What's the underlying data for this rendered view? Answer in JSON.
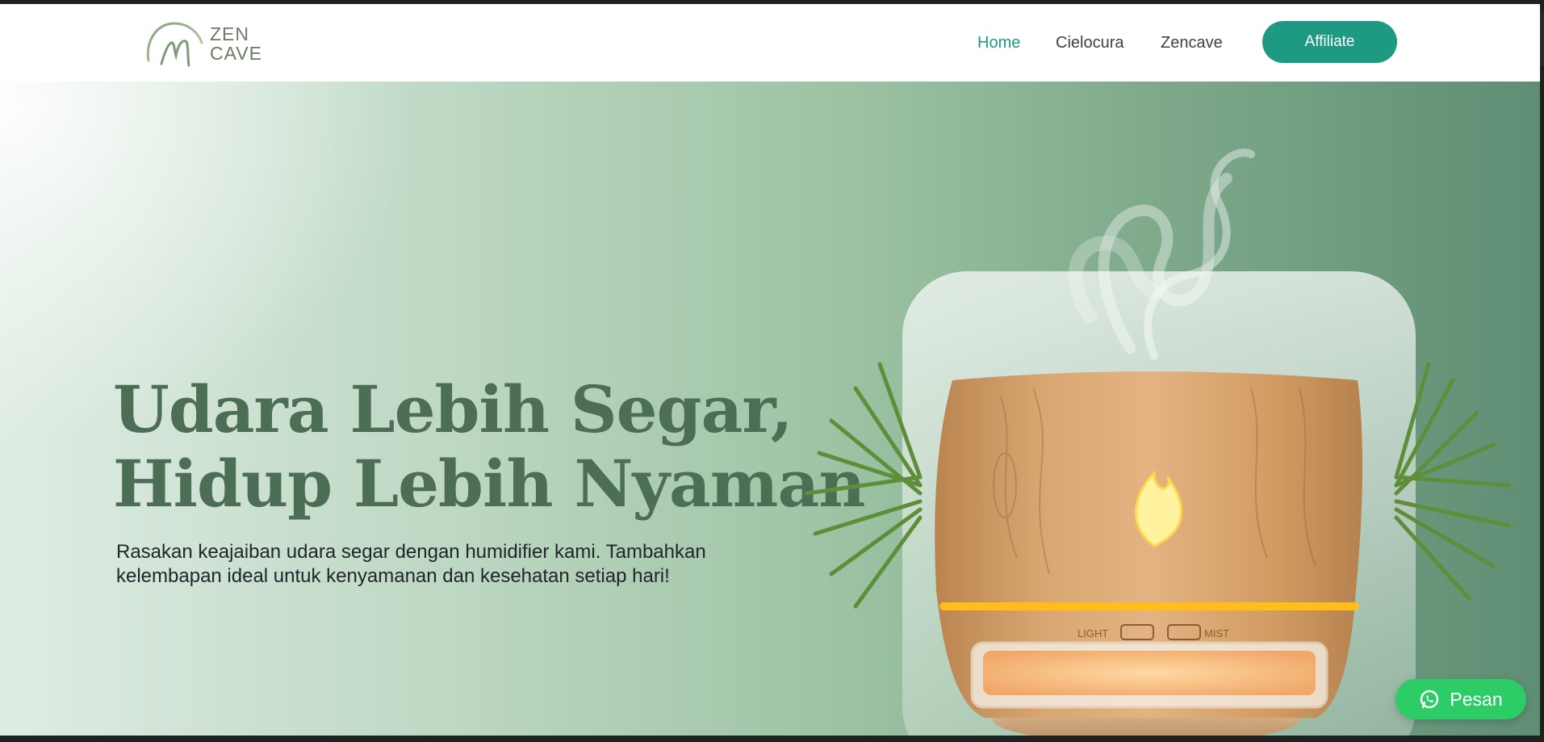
{
  "brand": {
    "line1": "ZEN",
    "line2": "CAVE",
    "color": "#6c7a66"
  },
  "nav": {
    "items": [
      {
        "label": "Home",
        "active": true
      },
      {
        "label": "Cielocura",
        "active": false
      },
      {
        "label": "Zencave",
        "active": false
      }
    ],
    "cta_label": "Affiliate",
    "accent": "#1e9a82"
  },
  "hero": {
    "title_line1": "Udara Lebih Segar,",
    "title_line2": "Hidup Lebih Nyaman",
    "description": "Rasakan keajaiban udara segar dengan humidifier kami. Tambahkan kelembapan ideal untuk kenyamanan dan kesehatan setiap hari!",
    "product_labels": {
      "left": "LIGHT",
      "right": "MIST"
    }
  },
  "whatsapp": {
    "label": "Pesan",
    "icon": "whatsapp-icon",
    "color": "#2ccd67"
  }
}
